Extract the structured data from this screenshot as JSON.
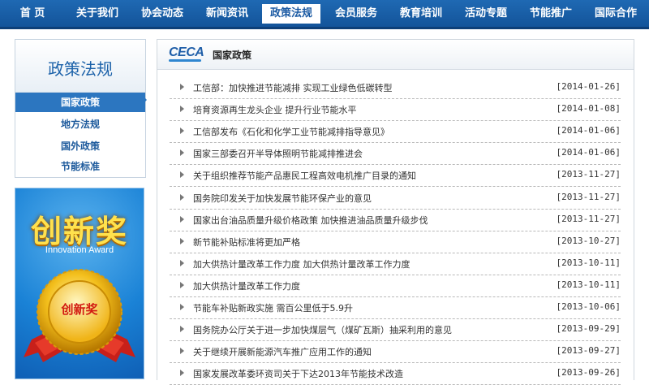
{
  "nav": {
    "items": [
      {
        "label": "首 页",
        "active": false
      },
      {
        "label": "关于我们",
        "active": false
      },
      {
        "label": "协会动态",
        "active": false
      },
      {
        "label": "新闻资讯",
        "active": false
      },
      {
        "label": "政策法规",
        "active": true
      },
      {
        "label": "会员服务",
        "active": false
      },
      {
        "label": "教育培训",
        "active": false
      },
      {
        "label": "活动专题",
        "active": false
      },
      {
        "label": "节能推广",
        "active": false
      },
      {
        "label": "国际合作",
        "active": false
      }
    ]
  },
  "sidebar": {
    "title": "政策法规",
    "items": [
      {
        "label": "国家政策",
        "active": true
      },
      {
        "label": "地方法规",
        "active": false
      },
      {
        "label": "国外政策",
        "active": false
      },
      {
        "label": "节能标准",
        "active": false
      }
    ]
  },
  "banner": {
    "title": "创新奖",
    "subtitle": "Innovation Award",
    "medal_text": "创新奖"
  },
  "main": {
    "logo": "CECA",
    "section_title": "国家政策",
    "rows": [
      {
        "title": "工信部：加快推进节能减排 实现工业绿色低碳转型",
        "date": "[2014-01-26]"
      },
      {
        "title": "培育资源再生龙头企业 提升行业节能水平",
        "date": "[2014-01-08]"
      },
      {
        "title": "工信部发布《石化和化学工业节能减排指导意见》",
        "date": "[2014-01-06]"
      },
      {
        "title": "国家三部委召开半导体照明节能减排推进会",
        "date": "[2014-01-06]"
      },
      {
        "title": "关于组织推荐节能产品惠民工程高效电机推广目录的通知",
        "date": "[2013-11-27]"
      },
      {
        "title": "国务院印发关于加快发展节能环保产业的意见",
        "date": "[2013-11-27]"
      },
      {
        "title": "国家出台油品质量升级价格政策 加快推进油品质量升级步伐",
        "date": "[2013-11-27]"
      },
      {
        "title": "新节能补贴标准将更加严格",
        "date": "[2013-10-27]"
      },
      {
        "title": "加大供热计量改革工作力度 加大供热计量改革工作力度",
        "date": "[2013-10-11]"
      },
      {
        "title": "加大供热计量改革工作力度",
        "date": "[2013-10-11]"
      },
      {
        "title": "节能车补贴新政实施 需百公里低于5.9升",
        "date": "[2013-10-06]"
      },
      {
        "title": "国务院办公厅关于进一步加快煤层气（煤矿瓦斯）抽采利用的意见",
        "date": "[2013-09-29]"
      },
      {
        "title": "关于继续开展新能源汽车推广应用工作的通知",
        "date": "[2013-09-27]"
      },
      {
        "title": "国家发展改革委环资司关于下达2013年节能技术改造",
        "date": "[2013-09-26]"
      }
    ]
  }
}
